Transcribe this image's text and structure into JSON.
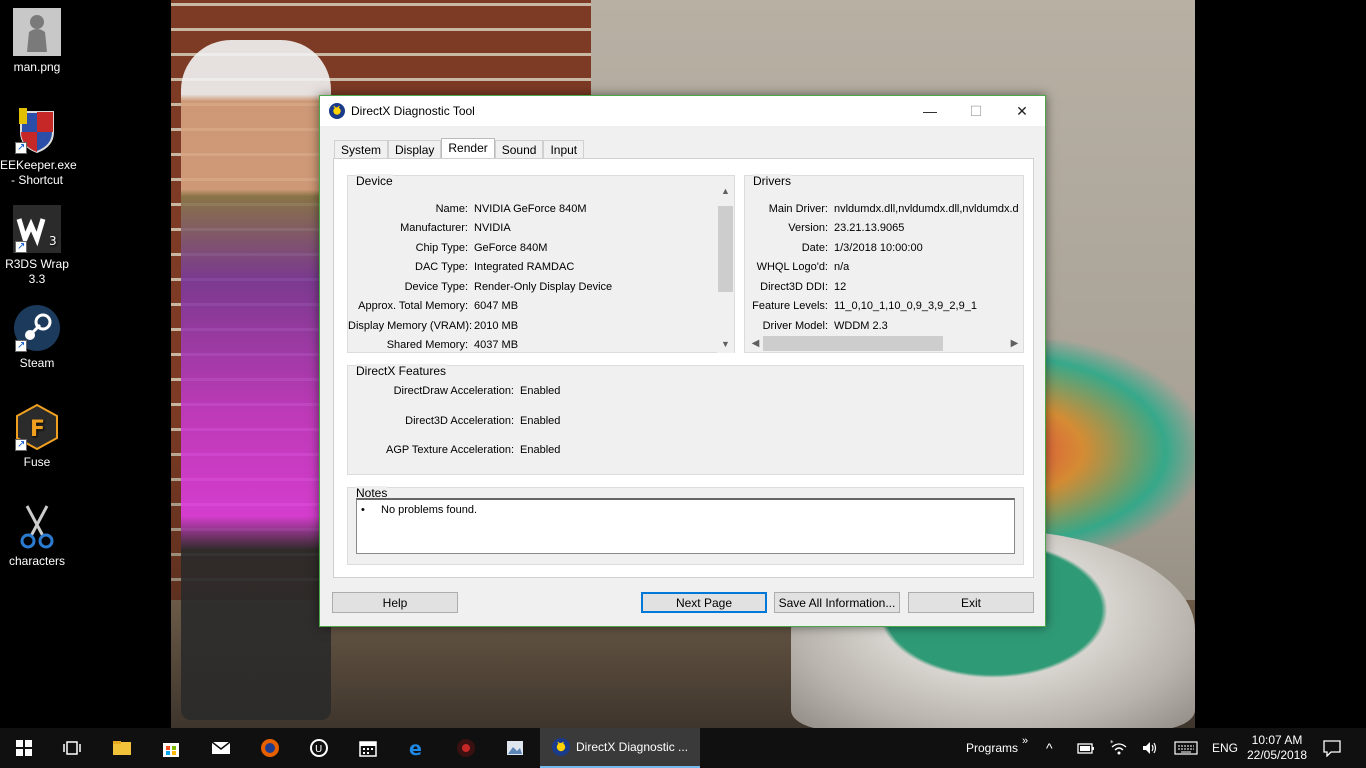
{
  "desktop": {
    "icons": [
      {
        "label": "man.png",
        "icon": "image-file-icon"
      },
      {
        "label": "EEKeeper.exe - Shortcut",
        "icon": "shield-icon"
      },
      {
        "label": "R3DS Wrap 3.3",
        "icon": "r3ds-wrap-icon"
      },
      {
        "label": "Steam",
        "icon": "steam-icon"
      },
      {
        "label": "Fuse",
        "icon": "fuse-icon"
      },
      {
        "label": "characters",
        "icon": "scissors-icon"
      }
    ]
  },
  "window": {
    "title": "DirectX Diagnostic Tool",
    "min_glyph": "—",
    "max_glyph": "☐",
    "close_glyph": "✕",
    "tabs": [
      {
        "label": "System"
      },
      {
        "label": "Display"
      },
      {
        "label": "Render"
      },
      {
        "label": "Sound"
      },
      {
        "label": "Input"
      }
    ],
    "active_tab": "Render",
    "device": {
      "title": "Device",
      "rows": [
        {
          "key": "Name:",
          "value": "NVIDIA GeForce 840M"
        },
        {
          "key": "Manufacturer:",
          "value": "NVIDIA"
        },
        {
          "key": "Chip Type:",
          "value": "GeForce 840M"
        },
        {
          "key": "DAC Type:",
          "value": "Integrated RAMDAC"
        },
        {
          "key": "Device Type:",
          "value": "Render-Only Display Device"
        },
        {
          "key": "Approx. Total Memory:",
          "value": "6047 MB"
        },
        {
          "key": "Display Memory (VRAM):",
          "value": "2010 MB"
        },
        {
          "key": "Shared Memory:",
          "value": "4037 MB"
        }
      ]
    },
    "drivers": {
      "title": "Drivers",
      "rows": [
        {
          "key": "Main Driver:",
          "value": "nvldumdx.dll,nvldumdx.dll,nvldumdx.d"
        },
        {
          "key": "Version:",
          "value": "23.21.13.9065"
        },
        {
          "key": "Date:",
          "value": "1/3/2018 10:00:00"
        },
        {
          "key": "WHQL Logo'd:",
          "value": "n/a"
        },
        {
          "key": "Direct3D DDI:",
          "value": "12"
        },
        {
          "key": "Feature Levels:",
          "value": "11_0,10_1,10_0,9_3,9_2,9_1"
        },
        {
          "key": "Driver Model:",
          "value": "WDDM 2.3"
        }
      ]
    },
    "features": {
      "title": "DirectX Features",
      "rows": [
        {
          "key": "DirectDraw Acceleration:",
          "value": "Enabled"
        },
        {
          "key": "Direct3D Acceleration:",
          "value": "Enabled"
        },
        {
          "key": "AGP Texture Acceleration:",
          "value": "Enabled"
        }
      ]
    },
    "notes": {
      "title": "Notes",
      "bullet": "•",
      "items": [
        "No problems found."
      ]
    },
    "buttons": {
      "help": "Help",
      "next_page": "Next Page",
      "save_all": "Save All Information...",
      "exit": "Exit"
    }
  },
  "taskbar": {
    "pinned": [
      "start-icon",
      "task-view-icon",
      "file-explorer-icon",
      "store-icon",
      "mail-icon",
      "firefox-icon",
      "unreal-engine-icon",
      "calendar-icon",
      "edge-icon",
      "app-icon",
      "photos-icon"
    ],
    "active_app": "DirectX Diagnostic ...",
    "programs_label": "Programs",
    "programs_glyph": "»",
    "language": "ENG",
    "time": "10:07 AM",
    "date": "22/05/2018"
  }
}
